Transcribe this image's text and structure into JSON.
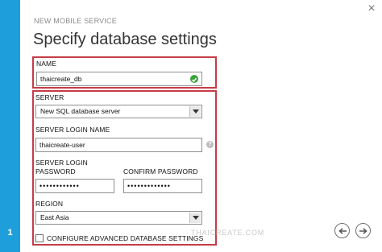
{
  "wizard": {
    "subtitle": "NEW MOBILE SERVICE",
    "title": "Specify database settings",
    "step_number": "1",
    "close_glyph": "×",
    "accent_color": "#1e9fdb",
    "highlight_color": "#c53c46"
  },
  "name_field": {
    "label": "NAME",
    "value": "thaicreate_db",
    "status_icon": "check-icon"
  },
  "server_section": {
    "server_label": "SERVER",
    "server_selected": "New SQL database server",
    "login_name_label": "SERVER LOGIN NAME",
    "login_name_value": "thaicreate-user",
    "help_glyph": "?",
    "login_password_label_line1": "SERVER LOGIN",
    "login_password_label_line2": "PASSWORD",
    "login_password_value": "••••••••••••",
    "confirm_password_label": "CONFIRM PASSWORD",
    "confirm_password_value": "•••••••••••••",
    "region_label": "REGION",
    "region_selected": "East Asia",
    "advanced_settings_label": "CONFIGURE ADVANCED DATABASE SETTINGS",
    "advanced_settings_checked": false
  },
  "watermark": "THAICREATE.COM",
  "navigation": {
    "back_icon": "arrow-left-icon",
    "next_icon": "arrow-right-icon"
  }
}
